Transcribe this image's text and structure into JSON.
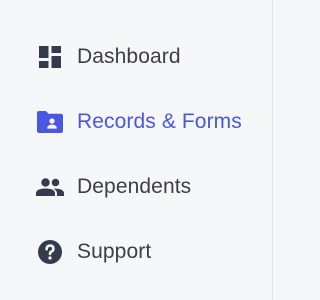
{
  "sidebar": {
    "items": [
      {
        "label": "Dashboard",
        "icon": "dashboard-icon",
        "active": false
      },
      {
        "label": "Records & Forms",
        "icon": "folder-user-icon",
        "active": true
      },
      {
        "label": "Dependents",
        "icon": "people-icon",
        "active": false
      },
      {
        "label": "Support",
        "icon": "question-circle-icon",
        "active": false
      }
    ]
  },
  "colors": {
    "background": "#f6f7f9",
    "text": "#3a3f4b",
    "active": "#4a57e0",
    "icon": "#353b4f"
  }
}
